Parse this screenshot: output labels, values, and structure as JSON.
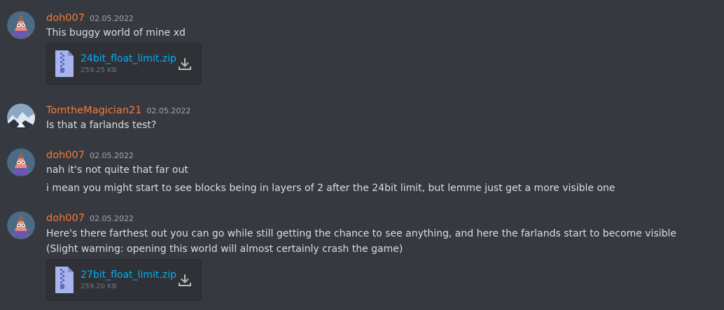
{
  "messages": [
    {
      "username": "doh007",
      "timestamp": "02.05.2022",
      "lines": [
        "This buggy world of mine xd"
      ],
      "attachment": {
        "name": "24bit_float_limit.zip",
        "size": "259.25 KB"
      }
    },
    {
      "username": "TomtheMagician21",
      "timestamp": "02.05.2022",
      "lines": [
        "Is that a farlands test?"
      ]
    },
    {
      "username": "doh007",
      "timestamp": "02.05.2022",
      "lines": [
        "nah it's not quite that far out",
        "i mean you might start to see blocks being in layers of 2 after the 24bit limit, but lemme just get a more visible one"
      ]
    },
    {
      "username": "doh007",
      "timestamp": "02.05.2022",
      "lines": [
        "Here's there farthest out you can go while still getting the chance to see anything, and here the farlands start to become visible",
        "(Slight warning: opening this world will almost certainly crash the game)"
      ],
      "attachment": {
        "name": "27bit_float_limit.zip",
        "size": "259.20 KB"
      }
    }
  ],
  "colors": {
    "background": "#36393f",
    "username": "#f47b3a",
    "link": "#00aff4",
    "attachment_bg": "#2f3136"
  }
}
